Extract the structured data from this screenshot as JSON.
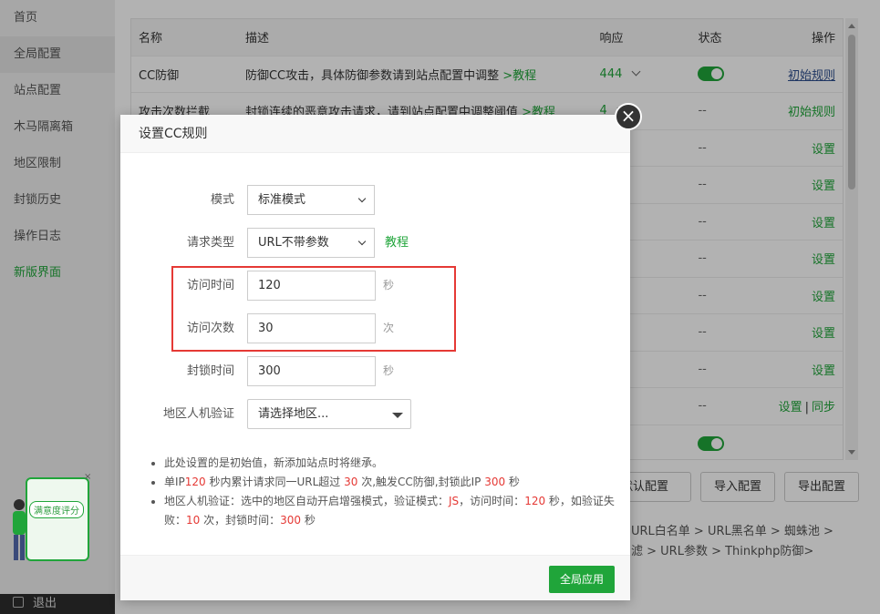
{
  "sidebar": {
    "items": [
      {
        "label": "首页"
      },
      {
        "label": "全局配置"
      },
      {
        "label": "站点配置"
      },
      {
        "label": "木马隔离箱"
      },
      {
        "label": "地区限制"
      },
      {
        "label": "封锁历史"
      },
      {
        "label": "操作日志"
      },
      {
        "label": "新版界面"
      }
    ],
    "logout": "退出"
  },
  "table": {
    "headers": {
      "name": "名称",
      "desc": "描述",
      "response": "响应",
      "status": "状态",
      "action": "操作"
    },
    "rows": [
      {
        "name": "CC防御",
        "desc": "防御CC攻击，具体防御参数请到站点配置中调整",
        "desc_link": ">教程",
        "response": "444",
        "status": "",
        "action": "初始规则"
      },
      {
        "name": "攻击次数拦截",
        "desc": "封锁连续的恶意攻击请求，请到站点配置中调整阈值",
        "desc_link": ">教程",
        "response": "4",
        "status": "--",
        "action": "初始规则"
      },
      {
        "name": "",
        "desc": "",
        "desc_link": "",
        "response": "",
        "status": "--",
        "action": "设置"
      },
      {
        "name": "",
        "desc": "",
        "desc_link": "",
        "response": "",
        "status": "--",
        "action": "设置"
      },
      {
        "name": "",
        "desc": "",
        "desc_link": "",
        "response": "",
        "status": "--",
        "action": "设置"
      },
      {
        "name": "",
        "desc": "",
        "desc_link": "",
        "response": "",
        "status": "--",
        "action": "设置"
      },
      {
        "name": "",
        "desc": "",
        "desc_link": "",
        "response": "",
        "status": "--",
        "action": "设置"
      },
      {
        "name": "",
        "desc": "",
        "desc_link": "",
        "response": "",
        "status": "--",
        "action": "设置"
      },
      {
        "name": "",
        "desc": "",
        "desc_link": "",
        "response": "",
        "status": "--",
        "action": "设置"
      },
      {
        "name": "",
        "desc": "",
        "desc_link": "",
        "response": "",
        "status": "--",
        "action": "设置",
        "action2": "同步",
        "sep": "|"
      },
      {
        "name": "",
        "desc": "",
        "desc_link": "",
        "response": "",
        "status": "",
        "action": ""
      }
    ]
  },
  "buttons": {
    "default_config": "默认配置",
    "import_config": "导入配置",
    "export_config": "导出配置"
  },
  "crumbs": {
    "line1": "URL白名单 > URL黑名单 > 蜘蛛池 >",
    "line2": "滤 > URL参数 > Thinkphp防御>"
  },
  "widget": {
    "label": "满意度评分",
    "close": "×"
  },
  "modal": {
    "title": "设置CC规则",
    "close": "×",
    "fields": {
      "mode": {
        "label": "模式",
        "value": "标准模式"
      },
      "request_type": {
        "label": "请求类型",
        "value": "URL不带参数",
        "link": "教程"
      },
      "visit_time": {
        "label": "访问时间",
        "value": "120",
        "unit": "秒"
      },
      "visit_count": {
        "label": "访问次数",
        "value": "30",
        "unit": "次"
      },
      "block_time": {
        "label": "封锁时间",
        "value": "300",
        "unit": "秒"
      },
      "region": {
        "label": "地区人机验证",
        "placeholder": "请选择地区..."
      }
    },
    "notes": {
      "n1": "此处设置的是初始值，新添加站点时将继承。",
      "n2_a": "单IP",
      "n2_v1": "120",
      "n2_b": " 秒内累计请求同一URL超过 ",
      "n2_v2": "30",
      "n2_c": " 次,触发CC防御,封锁此IP ",
      "n2_v3": "300",
      "n2_d": " 秒",
      "n3_a": "地区人机验证：选中的地区自动开启增强模式，验证模式：",
      "n3_v1": "JS",
      "n3_b": "，访问时间：",
      "n3_v2": "120",
      "n3_c": " 秒，如验证失败：",
      "n3_v3": "10",
      "n3_d": " 次，封锁时间：",
      "n3_v4": "300",
      "n3_e": " 秒"
    },
    "apply": "全局应用"
  },
  "colors": {
    "accent": "#20a53a",
    "highlight_box": "#e53935",
    "note_value": "#e53935"
  }
}
